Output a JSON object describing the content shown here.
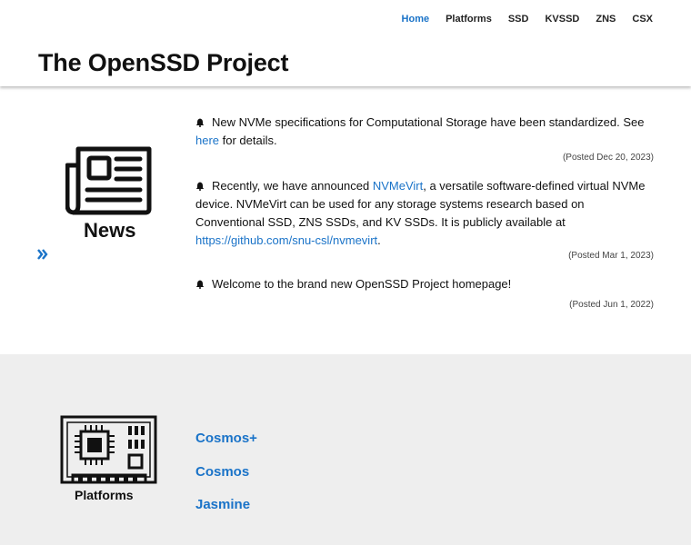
{
  "nav": {
    "items": [
      {
        "label": "Home",
        "active": true
      },
      {
        "label": "Platforms",
        "active": false
      },
      {
        "label": "SSD",
        "active": false
      },
      {
        "label": "KVSSD",
        "active": false
      },
      {
        "label": "ZNS",
        "active": false
      },
      {
        "label": "CSX",
        "active": false
      }
    ]
  },
  "site": {
    "title": "The OpenSSD Project"
  },
  "news": {
    "label": "News",
    "icon": "newspaper-icon",
    "more_icon": "double-chevron-right-icon",
    "items": [
      {
        "pre": "New NVMe specifications for Computational Storage have been standardized. See ",
        "link": "here",
        "post": " for details.",
        "date": "(Posted Dec 20, 2023)"
      },
      {
        "pre": "Recently, we have announced ",
        "link": "NVMeVirt",
        "mid": ", a versatile software-defined virtual NVMe device. NVMeVirt can be used for any storage systems research based on Conventional SSD, ZNS SSDs, and KV SSDs. It is publicly available at ",
        "link2": "https://github.com/snu-csl/nvmevirt",
        "post": ".",
        "date": "(Posted Mar 1, 2023)"
      },
      {
        "pre": "Welcome to the brand new OpenSSD Project homepage!",
        "date": "(Posted Jun 1, 2022)"
      }
    ]
  },
  "platforms": {
    "label": "Platforms",
    "icon": "circuit-board-icon",
    "links": [
      "Cosmos+",
      "Cosmos",
      "Jasmine"
    ]
  },
  "colors": {
    "accent": "#1a73c8",
    "platforms_bg": "#eeeeee"
  }
}
